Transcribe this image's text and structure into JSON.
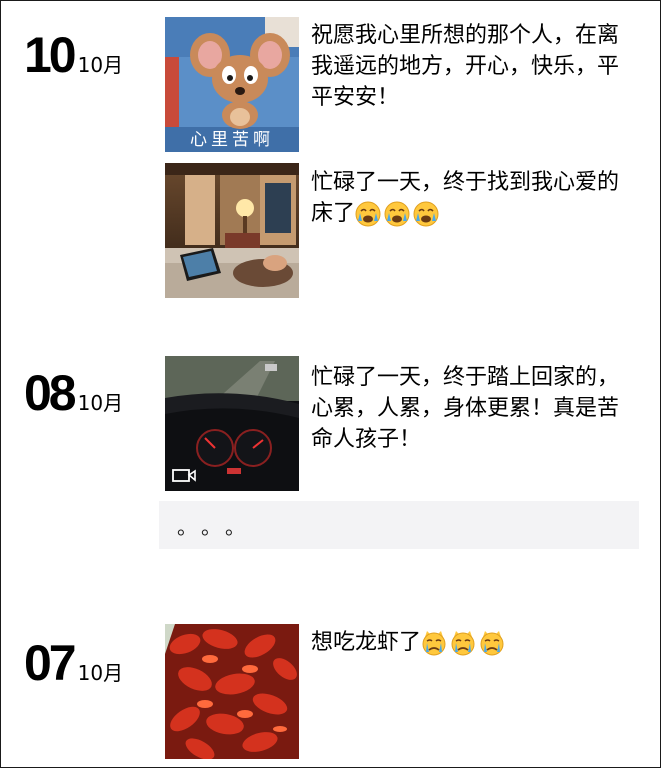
{
  "posts": [
    {
      "day": "10",
      "month": "10月"
    },
    {
      "day": "08",
      "month": "10月"
    },
    {
      "day": "07",
      "month": "10月"
    }
  ],
  "entries": [
    {
      "text": "祝愿我心里所想的那个人，在离我遥远的地方，开心，快乐，平平安安！",
      "caption": "心里苦啊",
      "icon": "tom-and-jerry-meme-image"
    },
    {
      "text": "忙碌了一天，终于找到我心爱的床了",
      "emoji": [
        "crying-face-emoji",
        "crying-face-emoji",
        "crying-face-emoji"
      ],
      "icon": "hotel-room-photo"
    },
    {
      "text": "忙碌了一天，终于踏上回家的，心累，人累，身体更累！真是苦命人孩子！",
      "icon": "car-dashboard-video"
    },
    {
      "text": "想吃龙虾了",
      "emoji": [
        "crying-cat-emoji",
        "crying-cat-emoji",
        "crying-cat-emoji"
      ],
      "icon": "crayfish-photo"
    }
  ],
  "comment": {
    "text": "。。。"
  },
  "colors": {
    "bubble": "#f3f3f5",
    "accent": "#ffc83d"
  }
}
